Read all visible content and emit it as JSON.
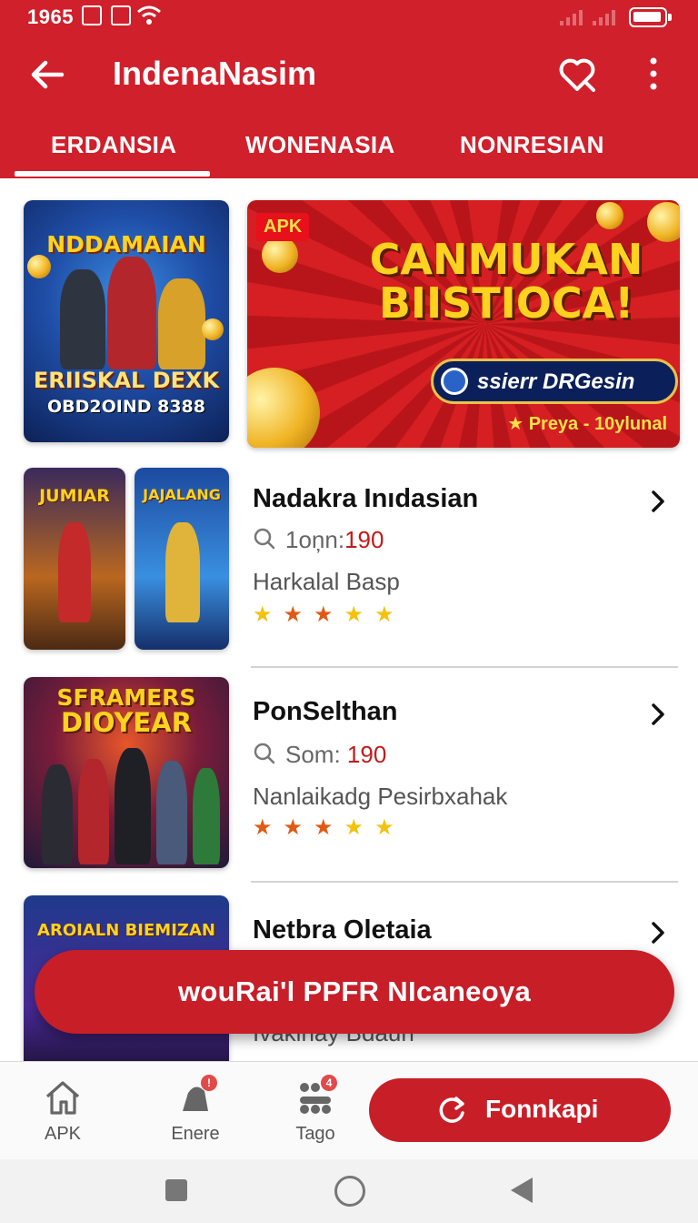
{
  "status_bar": {
    "time": "1965"
  },
  "appbar": {
    "title": "IndenaNasim"
  },
  "tabs": [
    {
      "label": "ERDANSIA",
      "active": true
    },
    {
      "label": "WONENASIA",
      "active": false
    },
    {
      "label": "NONRESIAN",
      "active": false
    }
  ],
  "featured": {
    "left": {
      "title": "NDDAMAIAN",
      "banner": "ERIISKAL DEXK",
      "code": "OBD2OIND 8388"
    },
    "right": {
      "tag": "APK",
      "headline_line1": "CANMUKAN",
      "headline_line2": "BIISTIOCA!",
      "pill_text": "ssierr DRGesin",
      "rating": "★ Preya - 10ylunal"
    }
  },
  "items": [
    {
      "title": "Nadakra Inıdasian",
      "meta_label": "1oņn:",
      "meta_value": "190",
      "subtitle": "Harkalal Basp",
      "thumb_a_text": "JUMIAR",
      "thumb_b_text": "JAJALANG"
    },
    {
      "title": "PonSelthan",
      "meta_label": "Som:",
      "meta_value": "190",
      "subtitle": "Nanlaikadg Pesirbxahak",
      "thumb_text_1": "SFRAMERS",
      "thumb_text_2": "DIOYEAR"
    },
    {
      "title": "Netbra Oletaia",
      "subtitle": "Ivakinay Bdaun",
      "thumb_text": "AROIALN BIEMIZAN"
    }
  ],
  "cta": {
    "label": "wouRai'l PPFR NIcaneoya"
  },
  "bottom_nav": {
    "items": [
      {
        "label": "APK",
        "icon": "home-icon"
      },
      {
        "label": "Enere",
        "icon": "bell-icon",
        "badge": "!"
      },
      {
        "label": "Tago",
        "icon": "apps-grid-icon",
        "badge": "4"
      }
    ],
    "primary_button": "Fonnkapi"
  },
  "colors": {
    "brand": "#d0202b",
    "accent_value": "#c41a1a",
    "star_orange": "#e05a14",
    "star_yellow": "#f4c20d"
  }
}
